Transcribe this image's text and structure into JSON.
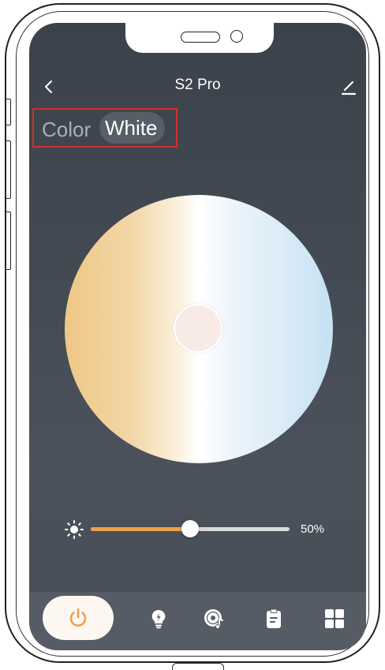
{
  "header": {
    "title": "S2 Pro",
    "back_icon": "chevron-left-icon",
    "edit_icon": "pencil-icon"
  },
  "mode_tabs": {
    "color_label": "Color",
    "white_label": "White",
    "active": "White"
  },
  "color_wheel": {
    "warm_color": "#eec785",
    "neutral_color": "#ffffff",
    "cool_color": "#c5e1f3",
    "selected_color": "#f8ebe6"
  },
  "brightness": {
    "icon": "sun-icon",
    "value": 50,
    "value_label": "50%",
    "fill_color": "#f0a04b"
  },
  "bottom_nav": {
    "items": [
      {
        "icon": "power-icon",
        "active": true
      },
      {
        "icon": "bulb-icon",
        "active": false
      },
      {
        "icon": "music-disc-icon",
        "active": false
      },
      {
        "icon": "clipboard-icon",
        "active": false
      },
      {
        "icon": "grid-icon",
        "active": false
      }
    ],
    "accent_color": "#f0a04b"
  },
  "theme": {
    "background": "#434a53",
    "highlight_box": "#d32f2f"
  }
}
